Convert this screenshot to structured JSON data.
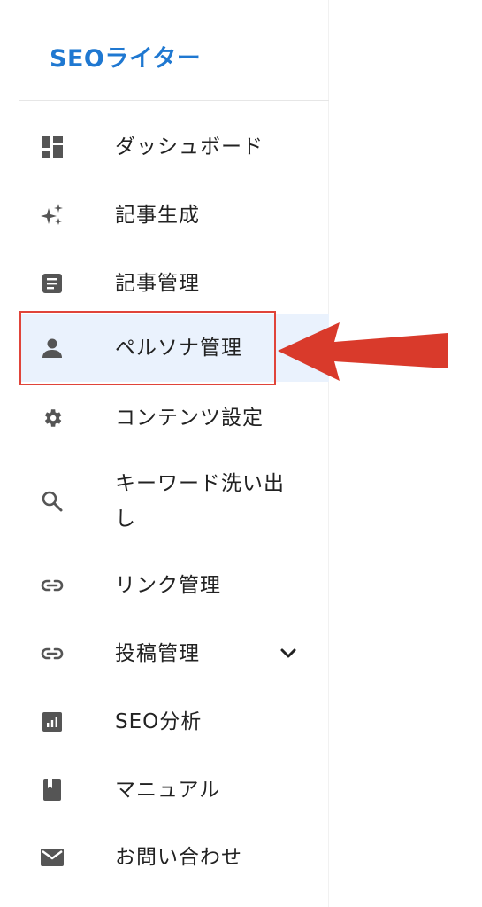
{
  "brand": {
    "title": "SEOライター",
    "color": "#1f78d1"
  },
  "nav": {
    "items": [
      {
        "label": "ダッシュボード",
        "icon": "dashboard-icon"
      },
      {
        "label": "記事生成",
        "icon": "sparkle-icon"
      },
      {
        "label": "記事管理",
        "icon": "article-icon"
      },
      {
        "label": "ペルソナ管理",
        "icon": "person-icon",
        "active": true
      },
      {
        "label": "コンテンツ設定",
        "icon": "gear-icon"
      },
      {
        "label": "キーワード洗い出",
        "label_line2": "し",
        "icon": "search-icon"
      },
      {
        "label": "リンク管理",
        "icon": "link-icon"
      },
      {
        "label": "投稿管理",
        "icon": "link-icon",
        "expandable": true
      },
      {
        "label": "SEO分析",
        "icon": "analytics-icon"
      },
      {
        "label": "マニュアル",
        "icon": "book-icon"
      },
      {
        "label": "お問い合わせ",
        "icon": "mail-icon"
      }
    ]
  },
  "annotation": {
    "highlight_color": "#e0443a",
    "arrow_color": "#d93a2b"
  }
}
